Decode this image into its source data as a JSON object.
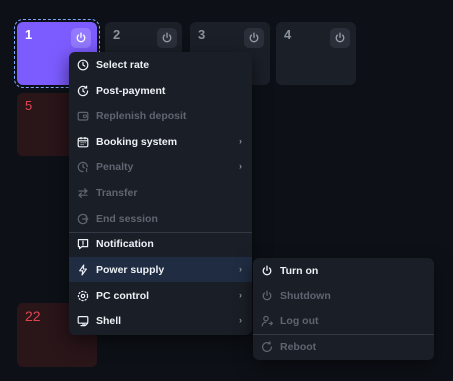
{
  "tiles": [
    {
      "number": "1",
      "state": "selected"
    },
    {
      "number": "2",
      "state": "normal"
    },
    {
      "number": "3",
      "state": "normal"
    },
    {
      "number": "4",
      "state": "normal"
    },
    {
      "number": "5",
      "state": "alert"
    },
    {
      "number": "22",
      "state": "alert"
    }
  ],
  "context_menu": {
    "items": [
      {
        "label": "Select rate",
        "icon": "clock-icon",
        "enabled": true
      },
      {
        "label": "Post-payment",
        "icon": "clock-arrow-icon",
        "enabled": true
      },
      {
        "label": "Replenish deposit",
        "icon": "wallet-icon",
        "enabled": false
      },
      {
        "label": "Booking system",
        "icon": "calendar-icon",
        "enabled": true,
        "submenu": true
      },
      {
        "label": "Penalty",
        "icon": "clock-alert-icon",
        "enabled": false,
        "submenu": true
      },
      {
        "label": "Transfer",
        "icon": "transfer-icon",
        "enabled": false
      },
      {
        "label": "End session",
        "icon": "exit-icon",
        "enabled": false
      },
      {
        "label": "Notification",
        "icon": "message-icon",
        "enabled": true
      },
      {
        "label": "Power supply",
        "icon": "lightning-icon",
        "enabled": true,
        "submenu": true,
        "highlighted": true
      },
      {
        "label": "PC control",
        "icon": "gear-icon",
        "enabled": true,
        "submenu": true
      },
      {
        "label": "Shell",
        "icon": "monitor-icon",
        "enabled": true,
        "submenu": true
      }
    ]
  },
  "power_submenu": {
    "items": [
      {
        "label": "Turn on",
        "icon": "power-icon",
        "enabled": true
      },
      {
        "label": "Shutdown",
        "icon": "power-icon",
        "enabled": false
      },
      {
        "label": "Log out",
        "icon": "user-logout-icon",
        "enabled": false
      },
      {
        "label": "Reboot",
        "icon": "reboot-icon",
        "enabled": false
      }
    ]
  },
  "colors": {
    "background": "#0d1117",
    "selected_tile": "#7c5cff",
    "alert_text": "#e0454f",
    "menu_bg": "#1a1e26",
    "highlight_bg": "#1f2c42"
  }
}
